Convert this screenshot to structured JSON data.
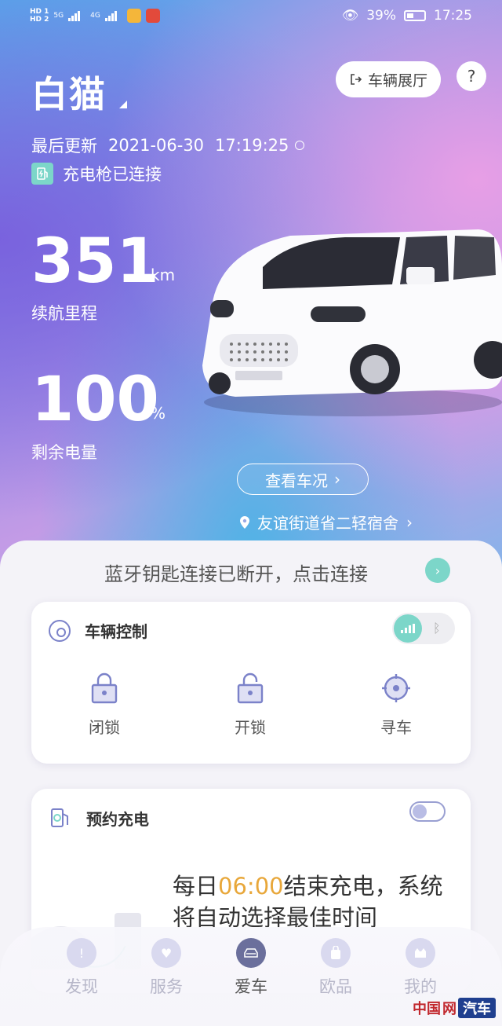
{
  "status_bar": {
    "left_indicators": [
      "HD 1",
      "HD 2",
      "5G",
      "4G"
    ],
    "eye_label": "👁",
    "battery_percent": "39%",
    "time": "17:25"
  },
  "header": {
    "car_name": "白猫",
    "showroom_label": "车辆展厅",
    "help_label": "?",
    "last_update_prefix": "最后更新",
    "last_update_date": "2021-06-30",
    "last_update_time": "17:19:25",
    "charge_status": "充电枪已连接"
  },
  "stats": {
    "range_value": "351",
    "range_unit": "km",
    "range_label": "续航里程",
    "battery_value": "100",
    "battery_unit": "%",
    "battery_label": "剩余电量"
  },
  "car_actions": {
    "view_status_label": "查看车况",
    "location_text": "友谊街道省二轻宿舍"
  },
  "bluetooth_banner": {
    "text": "蓝牙钥匙连接已断开，点击连接"
  },
  "vehicle_control": {
    "title": "车辆控制",
    "buttons": [
      {
        "label": "闭锁",
        "icon": "lock-icon"
      },
      {
        "label": "开锁",
        "icon": "unlock-icon"
      },
      {
        "label": "寻车",
        "icon": "locate-car-icon"
      }
    ]
  },
  "scheduled_charge": {
    "title": "预约充电",
    "text_prefix": "每日",
    "time": "06:00",
    "text_suffix": "结束充电，系统将自动选择最佳时间"
  },
  "bottom_nav": {
    "items": [
      {
        "label": "发现",
        "icon": "discover-icon",
        "active": false
      },
      {
        "label": "服务",
        "icon": "heart-icon",
        "active": false
      },
      {
        "label": "爱车",
        "icon": "car-icon",
        "active": true
      },
      {
        "label": "欧品",
        "icon": "shop-icon",
        "active": false
      },
      {
        "label": "我的",
        "icon": "profile-icon",
        "active": false
      }
    ]
  },
  "watermark": {
    "part1": "中国",
    "part2": "网",
    "part3": "汽车"
  },
  "colors": {
    "accent_teal": "#7cd6c9",
    "highlight_orange": "#e8a73a",
    "nav_active": "#6b6f9c"
  }
}
